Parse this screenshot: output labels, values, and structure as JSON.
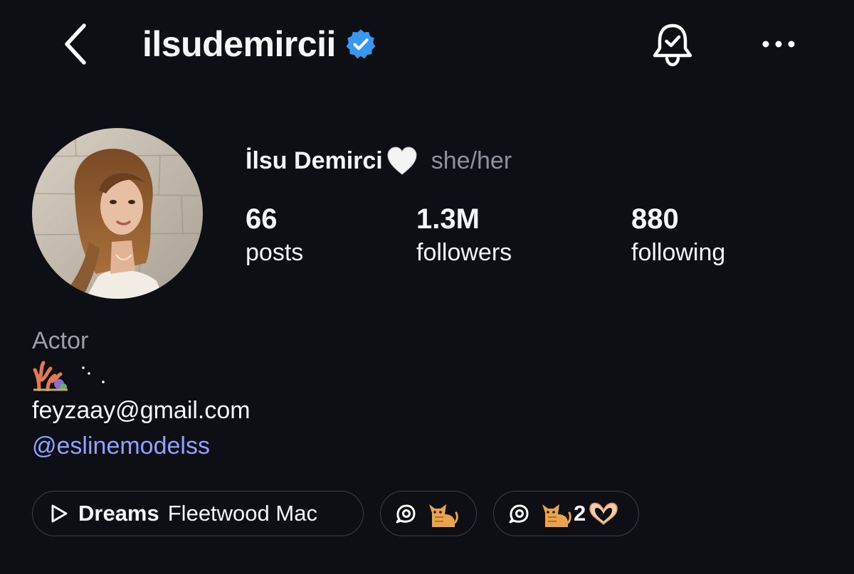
{
  "header": {
    "username": "ilsudemircii",
    "icons": {
      "back": "chevron-left-icon",
      "verified": "verified-badge-icon",
      "notifications": "bell-check-icon",
      "more": "more-horizontal-icon"
    },
    "colors": {
      "verified": "#3897f0",
      "background": "#0d0f14"
    }
  },
  "profile": {
    "display_name": "İlsu Demirci",
    "name_emoji": "white-heart",
    "pronouns": "she/her",
    "stats": [
      {
        "value": "66",
        "label": "posts"
      },
      {
        "value": "1.3M",
        "label": "followers"
      },
      {
        "value": "880",
        "label": "following"
      }
    ]
  },
  "bio": {
    "category": "Actor",
    "emoji_line": "coral-emoji + dots",
    "email": "feyzaay@gmail.com",
    "mention": "@eslinemodelss",
    "mention_color": "#8ea3ff"
  },
  "highlights": {
    "music": {
      "title": "Dreams",
      "artist": "Fleetwood Mac",
      "icon": "play-icon"
    },
    "note_pills": [
      {
        "icon": "threads-icon",
        "emoji": "cat"
      },
      {
        "icon": "threads-icon",
        "emoji": "cat",
        "count": "2",
        "emoji2": "heart-hands"
      }
    ]
  }
}
